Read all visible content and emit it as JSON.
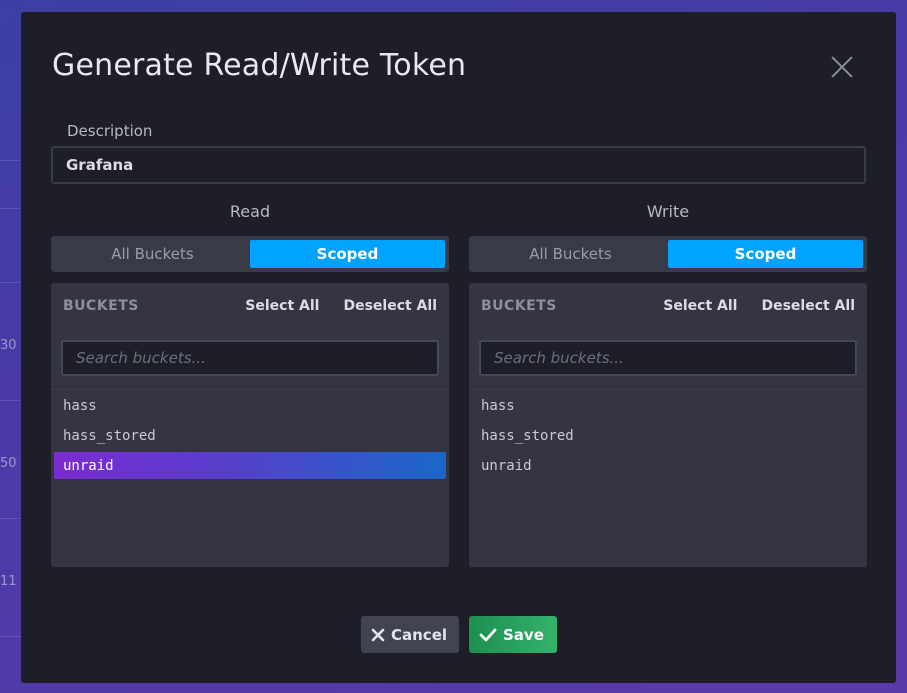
{
  "background": {
    "numbers": [
      "30",
      "50",
      "11"
    ]
  },
  "modal": {
    "title": "Generate Read/Write Token",
    "close_icon": "close-icon",
    "description": {
      "label": "Description",
      "value": "Grafana"
    },
    "read": {
      "heading": "Read",
      "toggle": {
        "all_label": "All Buckets",
        "scoped_label": "Scoped",
        "selected": "Scoped"
      },
      "panel_title": "BUCKETS",
      "select_all": "Select All",
      "deselect_all": "Deselect All",
      "search_placeholder": "Search buckets...",
      "buckets": [
        {
          "name": "hass",
          "selected": false
        },
        {
          "name": "hass_stored",
          "selected": false
        },
        {
          "name": "unraid",
          "selected": true
        }
      ]
    },
    "write": {
      "heading": "Write",
      "toggle": {
        "all_label": "All Buckets",
        "scoped_label": "Scoped",
        "selected": "Scoped"
      },
      "panel_title": "BUCKETS",
      "select_all": "Select All",
      "deselect_all": "Deselect All",
      "search_placeholder": "Search buckets...",
      "buckets": [
        {
          "name": "hass",
          "selected": false
        },
        {
          "name": "hass_stored",
          "selected": false
        },
        {
          "name": "unraid",
          "selected": false
        }
      ]
    },
    "footer": {
      "cancel_label": "Cancel",
      "cancel_icon": "x-icon",
      "save_label": "Save",
      "save_icon": "checkmark-icon"
    }
  },
  "colors": {
    "accent": "#00a3ff",
    "selected_gradient_start": "#7b2bd1",
    "selected_gradient_end": "#1a67c9",
    "save_green": "#34b36a"
  }
}
